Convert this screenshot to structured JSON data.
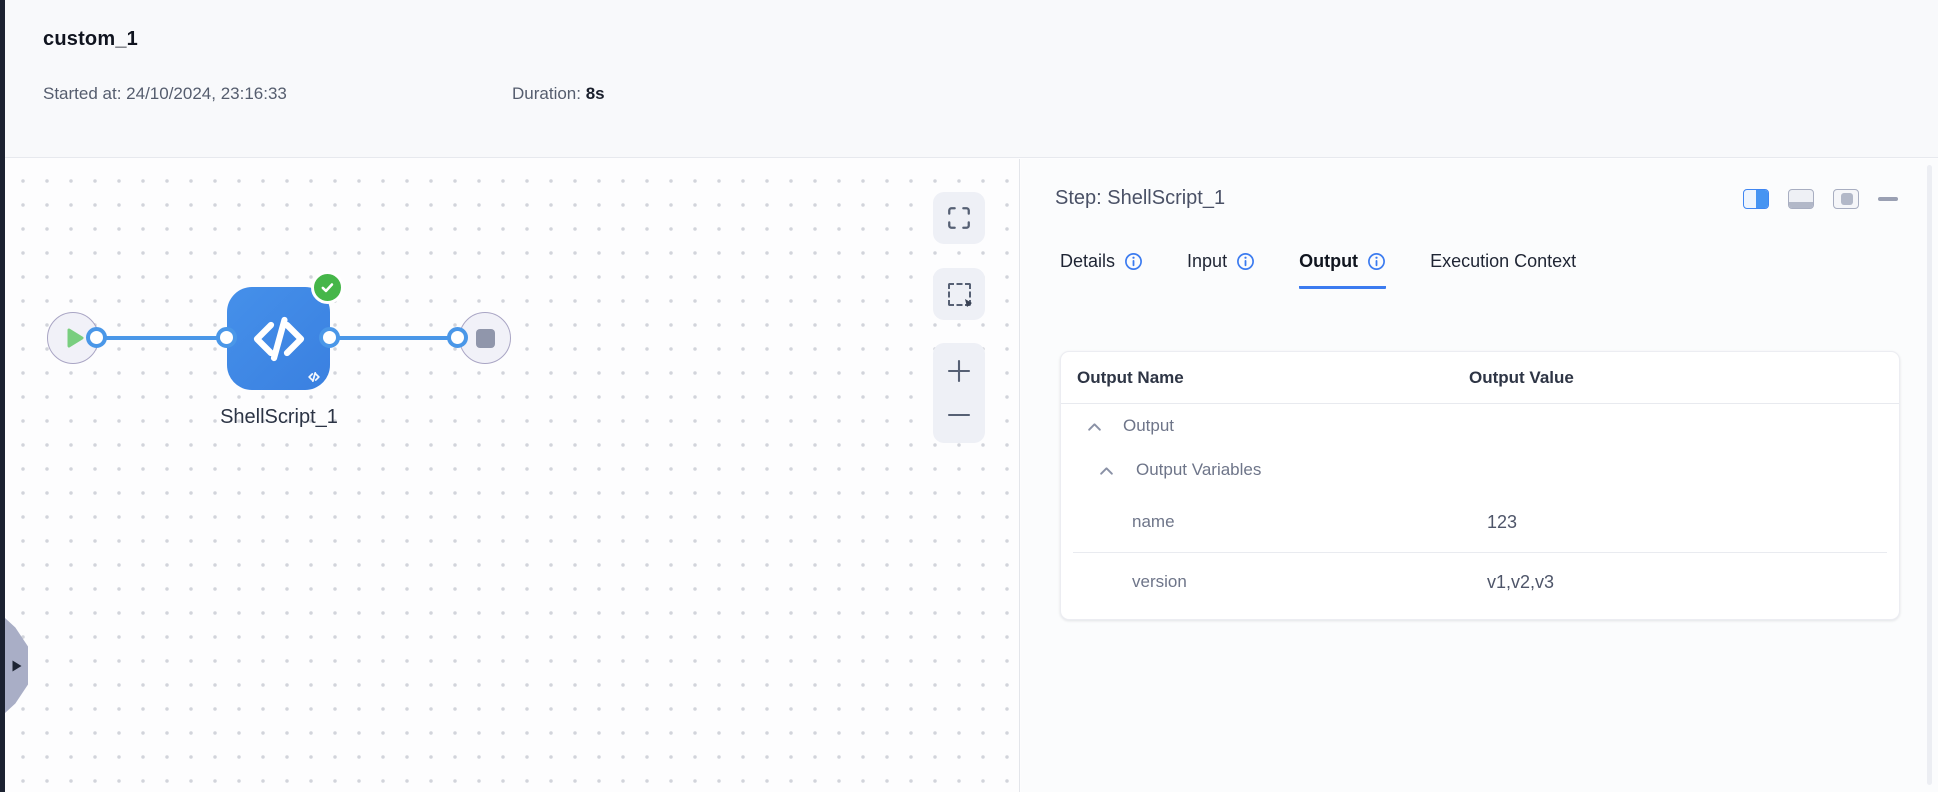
{
  "header": {
    "title": "custom_1",
    "started_label": "Started at:",
    "started_value": "24/10/2024, 23:16:33",
    "duration_label": "Duration:",
    "duration_value": "8s"
  },
  "canvas": {
    "node_label": "ShellScript_1",
    "node_status": "success",
    "icons": {
      "start": "play-triangle",
      "end": "stop-square",
      "node": "</>",
      "badge": "check",
      "fit_view": "corner-brackets",
      "marquee_select": "dashed-square",
      "zoom_in": "+",
      "zoom_out": "−",
      "expand_handle": "▶"
    }
  },
  "panel": {
    "title": "Step: ShellScript_1",
    "tabs": [
      {
        "label": "Details",
        "has_info": true,
        "active": false
      },
      {
        "label": "Input",
        "has_info": true,
        "active": false
      },
      {
        "label": "Output",
        "has_info": true,
        "active": true
      },
      {
        "label": "Execution Context",
        "has_info": false,
        "active": false
      }
    ],
    "window_controls": [
      "split-right",
      "split-bottom",
      "float-panel",
      "minimize"
    ],
    "table": {
      "columns": [
        "Output Name",
        "Output Value"
      ],
      "groups": [
        {
          "label": "Output",
          "level": 0,
          "expanded": true
        },
        {
          "label": "Output Variables",
          "level": 1,
          "expanded": true
        }
      ],
      "rows": [
        {
          "name": "name",
          "value": "123"
        },
        {
          "name": "version",
          "value": "v1,v2,v3"
        }
      ]
    }
  },
  "colors": {
    "node_blue": "#3d87e4",
    "edge_blue": "#4a97e8",
    "success_green": "#45b649",
    "start_play_green": "#79ce7f",
    "tab_active_blue": "#3b7bf0",
    "info_icon_blue": "#3b7bf0",
    "dark_rail": "#1c2231",
    "handle_gray": "#a9aec6"
  }
}
